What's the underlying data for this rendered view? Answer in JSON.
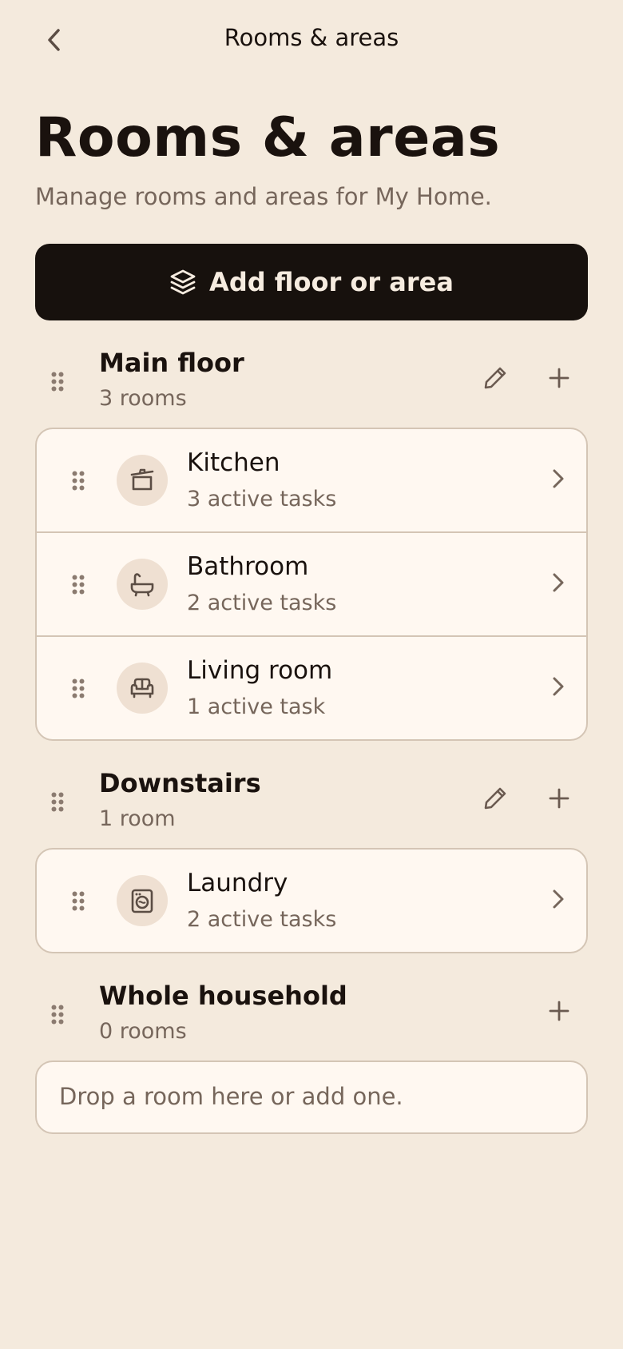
{
  "topbar": {
    "title": "Rooms & areas",
    "back_icon": "chevron-left-icon"
  },
  "header": {
    "title": "Rooms & areas",
    "subtitle": "Manage rooms and areas for My Home."
  },
  "add_button": {
    "label": "Add floor or area",
    "icon": "layers-icon"
  },
  "sections": [
    {
      "name": "Main floor",
      "count": "3 rooms",
      "rooms": [
        {
          "name": "Kitchen",
          "tasks": "3 active tasks",
          "icon": "cooking-pot-icon"
        },
        {
          "name": "Bathroom",
          "tasks": "2 active tasks",
          "icon": "bathtub-icon"
        },
        {
          "name": "Living room",
          "tasks": "1 active task",
          "icon": "sofa-icon"
        }
      ]
    },
    {
      "name": "Downstairs",
      "count": "1 room",
      "rooms": [
        {
          "name": "Laundry",
          "tasks": "2 active tasks",
          "icon": "washing-machine-icon"
        }
      ]
    },
    {
      "name": "Whole household",
      "count": "0 rooms",
      "empty_text": "Drop a room here or add one."
    }
  ],
  "colors": {
    "background": "#f4eadd",
    "card": "#fff8f1",
    "primary_button": "#17110d",
    "muted_text": "#76665b",
    "icon_bg": "#efe0d2"
  }
}
